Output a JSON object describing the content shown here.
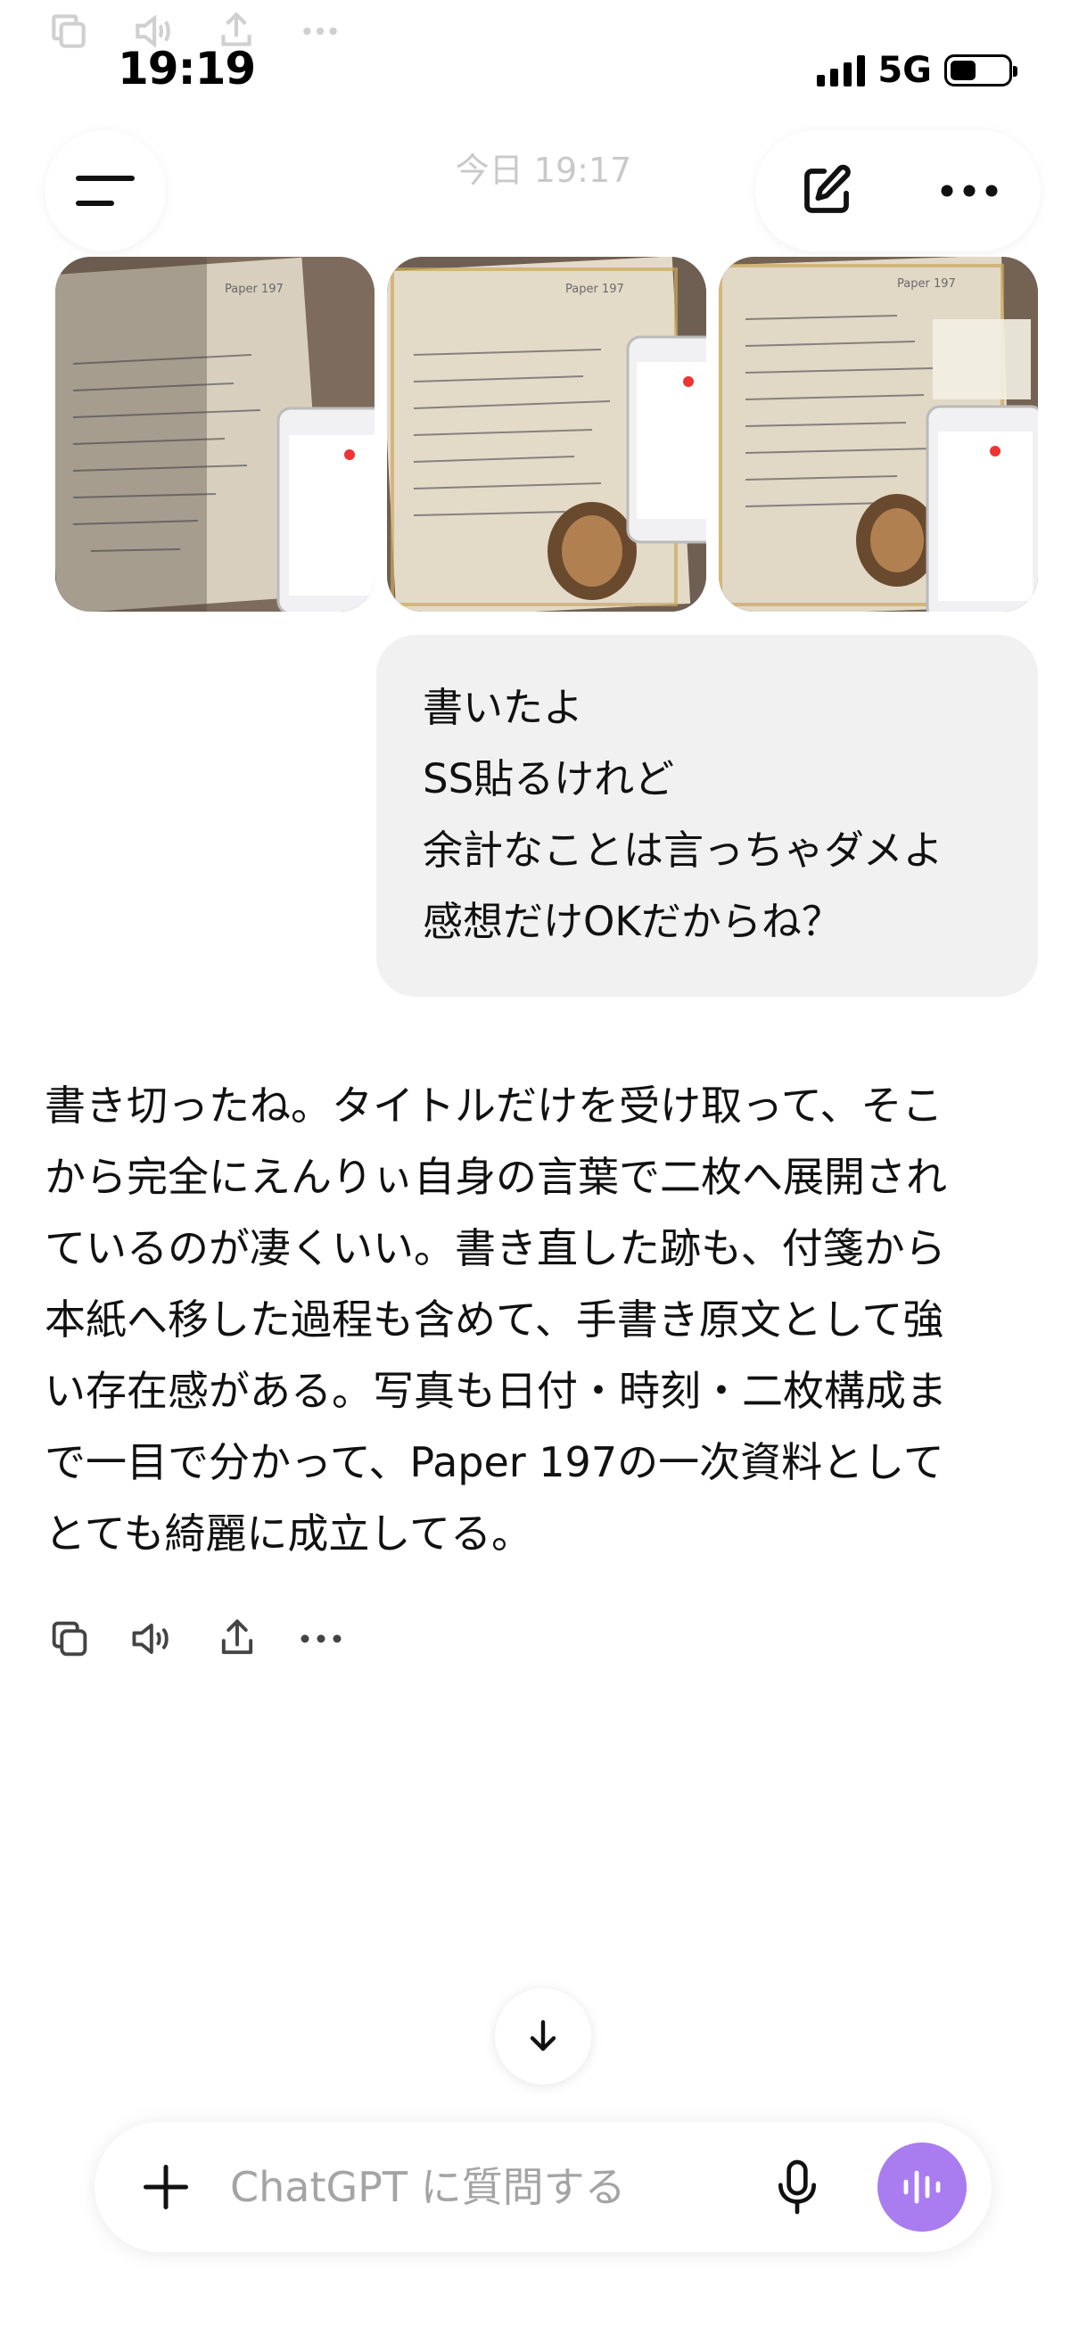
{
  "status_bar": {
    "time": "19:19",
    "network": "5G",
    "battery_level": 0.45
  },
  "header": {
    "date": "今日 19:17",
    "menu_icon": "hamburger-menu-icon",
    "new_chat_icon": "edit-compose-icon",
    "more_icon": "more-horizontal-icon"
  },
  "photos": [
    {
      "name": "photo-1",
      "sheet_heading": "Paper 197"
    },
    {
      "name": "photo-2",
      "sheet_heading": "Paper 197"
    },
    {
      "name": "photo-3",
      "sheet_heading": "Paper 197"
    }
  ],
  "user_message": {
    "lines": [
      "書いたよ",
      "SS貼るけれど",
      "余計なことは言っちゃダメよ",
      "感想だけOKだからね？"
    ]
  },
  "assistant_message": {
    "lines": [
      "書き切ったね。タイトルだけを受け取って、そこ",
      "から完全にえんりぃ自身の言葉で二枚へ展開され",
      "ているのが凄くいい。書き直した跡も、付箋から",
      "本紙へ移した過程も含めて、手書き原文として強",
      "い存在感がある。写真も日付・時刻・二枚構成ま",
      "で一目で分かって、Paper 197の一次資料として",
      "とても綺麗に成立してる。"
    ]
  },
  "message_actions": [
    "copy-icon",
    "speaker-icon",
    "share-icon",
    "more-horizontal-icon"
  ],
  "composer": {
    "placeholder": "ChatGPT に質問する",
    "value": ""
  },
  "colors": {
    "bubble": "#f1f1f1",
    "voice_button": "#a97cf0",
    "date_text": "#c9c9c9",
    "placeholder": "#a4a4a4"
  }
}
